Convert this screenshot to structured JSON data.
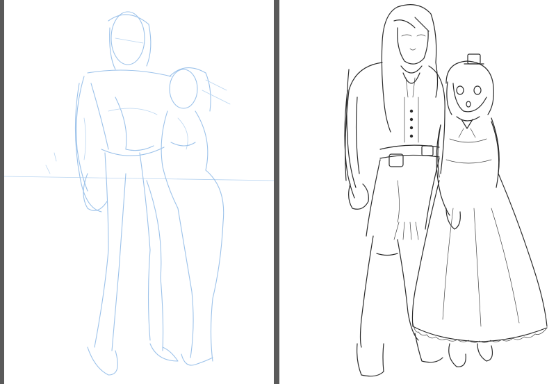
{
  "panels": {
    "left": {
      "kind": "pencil-sketch",
      "color": "#9cc2ea"
    },
    "right": {
      "kind": "lineart",
      "color": "#2a2a2a"
    }
  },
  "background_color": "#5a5a5a"
}
